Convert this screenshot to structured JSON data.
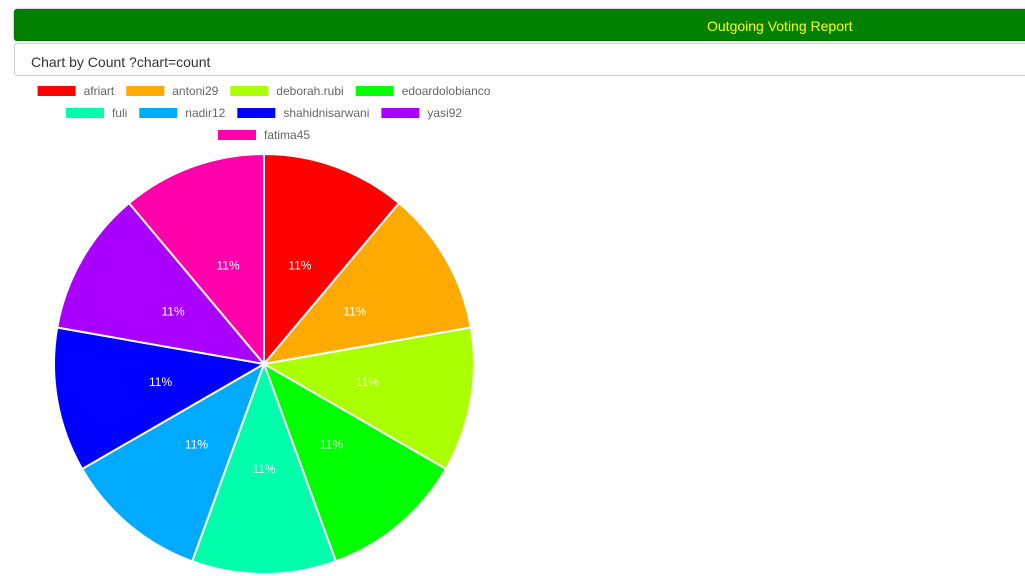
{
  "header": {
    "title": "Outgoing Voting Report"
  },
  "panel": {
    "subtitle": "Chart by Count ?chart=count"
  },
  "chart_data": {
    "type": "pie",
    "title": "",
    "categories": [
      "afriart",
      "antoni29",
      "deborah.rubi",
      "edoardolobianco",
      "fuli",
      "nadir12",
      "shahidnisarwani",
      "yasi92",
      "fatima45"
    ],
    "values": [
      1,
      1,
      1,
      1,
      1,
      1,
      1,
      1,
      1
    ],
    "labels": [
      "11%",
      "11%",
      "11%",
      "11%",
      "11%",
      "11%",
      "11%",
      "11%",
      "11%"
    ],
    "colors": [
      "#ff0000",
      "#ffaa00",
      "#aaff00",
      "#00ff00",
      "#00ffaa",
      "#00aaff",
      "#0000ff",
      "#aa00ff",
      "#ff00aa"
    ],
    "legend_position": "top"
  }
}
